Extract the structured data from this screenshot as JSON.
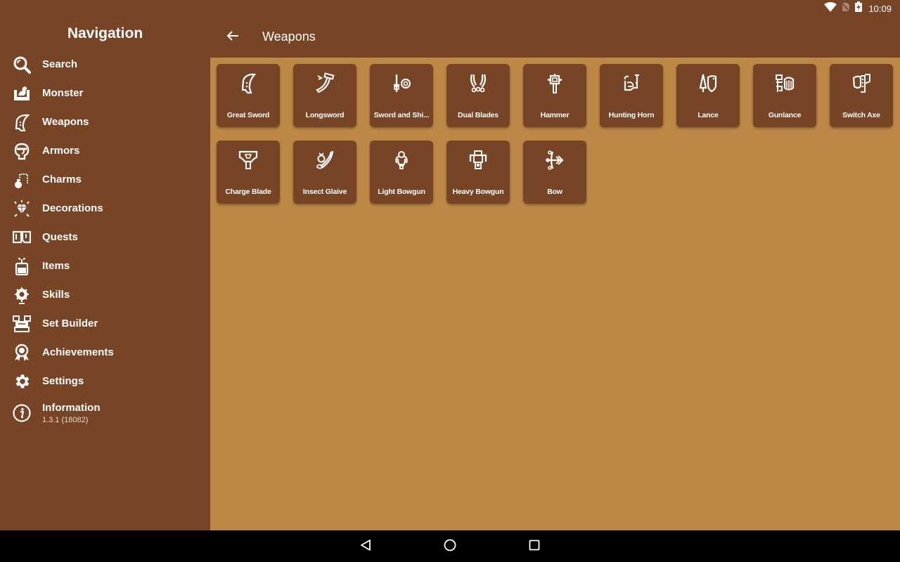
{
  "status_bar": {
    "time": "10:09",
    "icons": [
      "wifi-icon",
      "no-sim-icon",
      "battery-charging-icon"
    ]
  },
  "sidebar": {
    "title": "Navigation",
    "items": [
      {
        "label": "Search",
        "icon": "search-icon"
      },
      {
        "label": "Monster",
        "icon": "monster-icon"
      },
      {
        "label": "Weapons",
        "icon": "weapons-icon"
      },
      {
        "label": "Armors",
        "icon": "armor-icon"
      },
      {
        "label": "Charms",
        "icon": "charm-icon"
      },
      {
        "label": "Decorations",
        "icon": "decoration-icon"
      },
      {
        "label": "Quests",
        "icon": "quest-icon"
      },
      {
        "label": "Items",
        "icon": "item-icon"
      },
      {
        "label": "Skills",
        "icon": "skill-icon"
      },
      {
        "label": "Set Builder",
        "icon": "set-builder-icon"
      },
      {
        "label": "Achievements",
        "icon": "achievement-icon"
      },
      {
        "label": "Settings",
        "icon": "settings-icon"
      },
      {
        "label": "Information",
        "icon": "info-icon",
        "sublabel": "1.3.1 (18082)"
      }
    ]
  },
  "appbar": {
    "back_icon": "arrow-back-icon",
    "title": "Weapons"
  },
  "weapons": [
    {
      "label": "Great Sword",
      "icon": "great-sword-icon"
    },
    {
      "label": "Longsword",
      "icon": "longsword-icon"
    },
    {
      "label": "Sword and Shi...",
      "icon": "sword-and-shield-icon"
    },
    {
      "label": "Dual Blades",
      "icon": "dual-blades-icon"
    },
    {
      "label": "Hammer",
      "icon": "hammer-icon"
    },
    {
      "label": "Hunting Horn",
      "icon": "hunting-horn-icon"
    },
    {
      "label": "Lance",
      "icon": "lance-icon"
    },
    {
      "label": "Gunlance",
      "icon": "gunlance-icon"
    },
    {
      "label": "Switch Axe",
      "icon": "switch-axe-icon"
    },
    {
      "label": "Charge Blade",
      "icon": "charge-blade-icon"
    },
    {
      "label": "Insect Glaive",
      "icon": "insect-glaive-icon"
    },
    {
      "label": "Light Bowgun",
      "icon": "light-bowgun-icon"
    },
    {
      "label": "Heavy Bowgun",
      "icon": "heavy-bowgun-icon"
    },
    {
      "label": "Bow",
      "icon": "bow-icon"
    }
  ],
  "nav_buttons": [
    "back-nav-icon",
    "home-nav-icon",
    "recents-nav-icon"
  ],
  "colors": {
    "primary": "#774426",
    "content_bg": "#bd8846",
    "text": "#ffffff"
  }
}
